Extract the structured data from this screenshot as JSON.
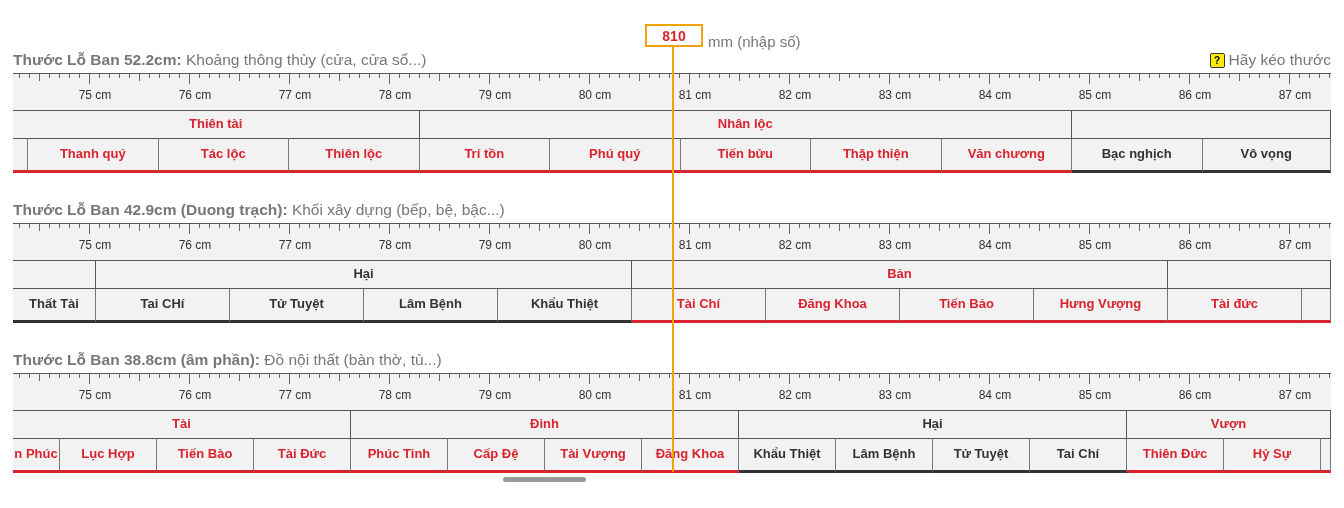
{
  "input": {
    "value": "810",
    "unit": "mm (nhập số)"
  },
  "hint": {
    "icon": "?",
    "text": "Hãy kéo thước"
  },
  "rulers": [
    {
      "title": "**Thước Lỗ Ban 52.2cm:** Khoảng thông thủy (cửa, cửa sổ...)",
      "ticks": [
        "75 cm",
        "76 cm",
        "77 cm",
        "78 cm",
        "79 cm",
        "80 cm",
        "81 cm",
        "82 cm",
        "83 cm",
        "84 cm",
        "85 cm",
        "86 cm",
        "87 cm"
      ],
      "groups": [
        {
          "label": "Thiên tài",
          "good": true,
          "cells": [
            {
              "kind": "blank"
            },
            {
              "kind": "named",
              "label": "Thanh quý"
            },
            {
              "kind": "named",
              "label": "Tác lộc"
            },
            {
              "kind": "named",
              "label": "Thiên lộc"
            }
          ]
        },
        {
          "label": "Nhân lộc",
          "good": true,
          "cells": [
            {
              "kind": "named",
              "label": "Trí tồn"
            },
            {
              "kind": "named",
              "label": "Phú quý"
            },
            {
              "kind": "named",
              "label": "Tiến bửu"
            },
            {
              "kind": "named",
              "label": "Thập thiện"
            },
            {
              "kind": "named",
              "label": "Văn chương"
            }
          ]
        },
        {
          "good": false,
          "cells": [
            {
              "kind": "named",
              "label": "Bạc nghịch"
            },
            {
              "kind": "named",
              "label": "Vô vọng"
            }
          ]
        }
      ]
    },
    {
      "title": "**Thước Lỗ Ban 42.9cm (Duong trạch):** Khối xây dựng (bếp, bệ, bậc...)",
      "ticks": [
        "75 cm",
        "76 cm",
        "77 cm",
        "78 cm",
        "79 cm",
        "80 cm",
        "81 cm",
        "82 cm",
        "83 cm",
        "84 cm",
        "85 cm",
        "86 cm",
        "87 cm"
      ],
      "groups": [
        {
          "good": false,
          "cells": [
            {
              "kind": "named",
              "label": "Thất Tài"
            }
          ]
        },
        {
          "label": "Hại",
          "good": false,
          "cells": [
            {
              "kind": "named",
              "label": "Tai CHí"
            },
            {
              "kind": "named",
              "label": "Tử Tuyệt"
            },
            {
              "kind": "named",
              "label": "Lâm Bệnh"
            },
            {
              "kind": "named",
              "label": "Khẩu Thiệt"
            }
          ]
        },
        {
          "label": "Bản",
          "good": true,
          "cells": [
            {
              "kind": "named",
              "label": "Tài Chí"
            },
            {
              "kind": "named",
              "label": "Đăng Khoa"
            },
            {
              "kind": "named",
              "label": "Tiến Bảo"
            },
            {
              "kind": "named",
              "label": "Hưng Vượng"
            }
          ]
        },
        {
          "good": true,
          "cells": [
            {
              "kind": "named",
              "label": "Tài đức"
            },
            {
              "kind": "blank"
            }
          ]
        }
      ]
    },
    {
      "title": "**Thước Lỗ Ban 38.8cm (âm phần):** Đồ nội thất (bàn thờ, tủ...)",
      "ticks": [
        "75 cm",
        "76 cm",
        "77 cm",
        "78 cm",
        "79 cm",
        "80 cm",
        "81 cm",
        "82 cm",
        "83 cm",
        "84 cm",
        "85 cm",
        "86 cm",
        "87 cm"
      ],
      "groups": [
        {
          "label": "Tài",
          "good": true,
          "cells": [
            {
              "kind": "named",
              "label": "n Phúc"
            },
            {
              "kind": "named",
              "label": "Lục Hợp"
            },
            {
              "kind": "named",
              "label": "Tiến Bào"
            },
            {
              "kind": "named",
              "label": "Tài Đức"
            }
          ]
        },
        {
          "label": "Đinh",
          "good": true,
          "cells": [
            {
              "kind": "named",
              "label": "Phúc Tinh"
            },
            {
              "kind": "named",
              "label": "Cấp Đệ"
            },
            {
              "kind": "named",
              "label": "Tài Vượng"
            },
            {
              "kind": "named",
              "label": "Đăng Khoa"
            }
          ]
        },
        {
          "label": "Hại",
          "good": false,
          "cells": [
            {
              "kind": "named",
              "label": "Khẩu Thiệt"
            },
            {
              "kind": "named",
              "label": "Lâm Bệnh"
            },
            {
              "kind": "named",
              "label": "Tử Tuyệt"
            },
            {
              "kind": "named",
              "label": "Tai Chí"
            }
          ]
        },
        {
          "label": "Vượn",
          "good": true,
          "cells": [
            {
              "kind": "named",
              "label": "Thiên Đức"
            },
            {
              "kind": "named",
              "label": "Hỷ Sự"
            },
            {
              "kind": "blank"
            }
          ]
        }
      ]
    }
  ]
}
